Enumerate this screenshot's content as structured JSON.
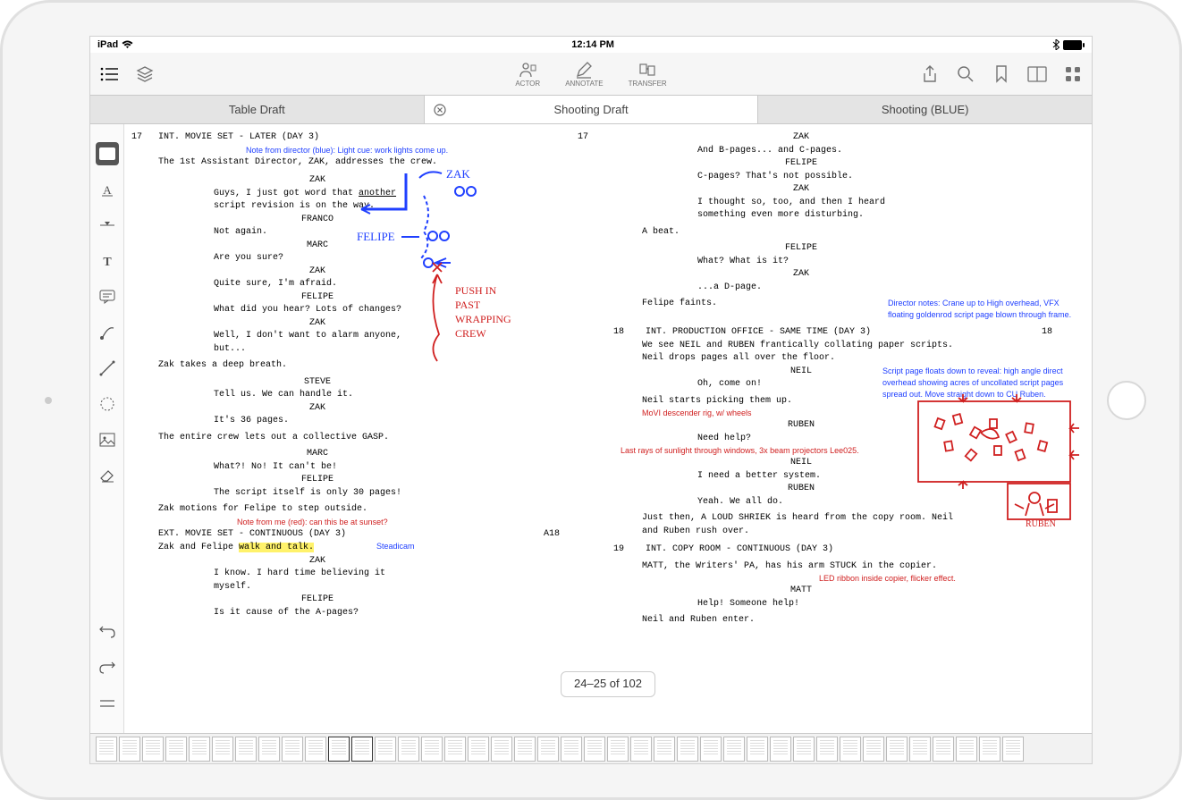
{
  "status_bar": {
    "device": "iPad",
    "time": "12:14 PM"
  },
  "toolbar": {
    "actor": "ACTOR",
    "annotate": "ANNOTATE",
    "transfer": "TRANSFER"
  },
  "tabs": [
    {
      "label": "Table Draft",
      "active": false
    },
    {
      "label": "Shooting Draft",
      "active": true,
      "closable": true
    },
    {
      "label": "Shooting (BLUE)",
      "active": false
    }
  ],
  "page_indicator": "24–25 of 102",
  "left_page": {
    "number": "17",
    "number_right": "17",
    "slug": "INT. MOVIE SET - LATER (DAY 3)",
    "note_director": "Note from director (blue): Light cue: work lights come up.",
    "l1": "The 1st Assistant Director, ZAK, addresses the crew.",
    "c1": "ZAK",
    "d1a": "Guys, I just got word that ",
    "d1u": "another",
    "d1b": "script revision is on the way.",
    "c2": "FRANCO",
    "d2": "Not again.",
    "c3": "MARC",
    "d3": "Are you sure?",
    "c4": "ZAK",
    "d4": "Quite sure, I'm afraid.",
    "c5": "FELIPE",
    "d5": "What did you hear? Lots of changes?",
    "c6": "ZAK",
    "d6": "Well, I don't want to alarm anyone, but...",
    "a2": "Zak takes a deep breath.",
    "c7": "STEVE",
    "d7": "Tell us. We can handle it.",
    "c8": "ZAK",
    "d8": "It's 36 pages.",
    "a3": "The entire crew lets out a collective GASP.",
    "c9": "MARC",
    "d9": "What?! No! It can't be!",
    "c10": "FELIPE",
    "d10": "The script itself is only 30 pages!",
    "a4": "Zak motions for Felipe to step outside.",
    "note_me": "Note from me (red): can this be at sunset?",
    "slug2": "EXT. MOVIE SET - CONTINUOUS (DAY 3)",
    "slug2_num": "A18",
    "a5a": "Zak and Felipe ",
    "a5h": "walk and talk.",
    "steadicam": "Steadicam",
    "c11": "ZAK",
    "d11": "I know. I hard time believing it myself.",
    "c12": "FELIPE",
    "d12": "Is it cause of the A-pages?",
    "hw_zak": "ZAK",
    "hw_felipe": "FELIPE",
    "hw_pushin": "PUSH IN PAST WRAPPING CREW"
  },
  "right_page": {
    "c1": "ZAK",
    "d1": "And B-pages... and C-pages.",
    "c2": "FELIPE",
    "d2": "C-pages? That's not possible.",
    "c3": "ZAK",
    "d3": "I thought so, too, and then I heard something even more disturbing.",
    "a1": "A beat.",
    "c4": "FELIPE",
    "d4": "What? What is it?",
    "c5": "ZAK",
    "d5": "...a D-page.",
    "a2": "Felipe faints.",
    "note_crane": "Director notes: Crane up to High overhead, VFX floating goldenrod script page blown through frame.",
    "num18": "18",
    "num18r": "18",
    "slug18": "INT. PRODUCTION OFFICE - SAME TIME (DAY 3)",
    "a3": "We see NEIL and RUBEN frantically collating paper scripts. Neil drops pages all over the floor.",
    "c6": "NEIL",
    "d6": "Oh, come on!",
    "note_float": "Script page floats down to reveal: high angle direct overhead showing acres of uncollated script pages spread out. Move straight down to CU Ruben.",
    "a4": "Neil starts picking them up.",
    "note_movi": "MoVI descender rig, w/ wheels",
    "c7": "RUBEN",
    "d7": "Need help?",
    "note_rays": "Last rays of sunlight through windows, 3x beam projectors Lee025.",
    "c8": "NEIL",
    "d8": "I need a better system.",
    "c9": "RUBEN",
    "d9": "Yeah. We all do.",
    "a5": "Just then, A LOUD SHRIEK is heard from the copy room. Neil and Ruben rush over.",
    "num19": "19",
    "slug19": "INT. COPY ROOM - CONTINUOUS (DAY 3)",
    "a6": "MATT, the Writers' PA, has his arm STUCK in the copier.",
    "note_led": "LED ribbon inside copier, flicker effect.",
    "c10": "MATT",
    "d10": "Help! Someone help!",
    "a7": "Neil and Ruben enter.",
    "hw_ruben": "RUBEN"
  }
}
